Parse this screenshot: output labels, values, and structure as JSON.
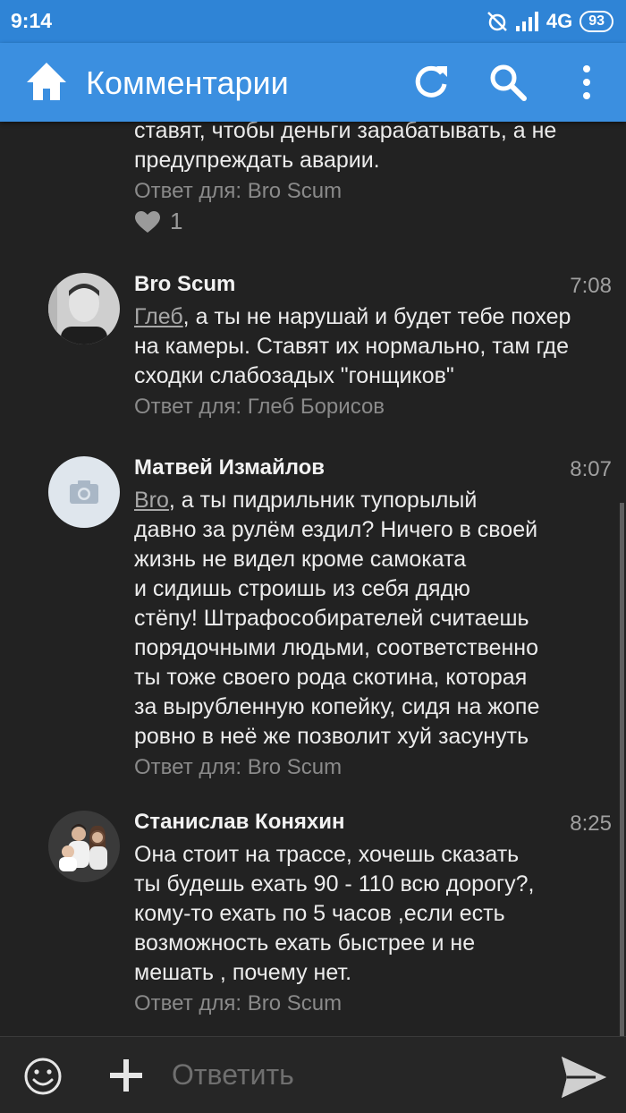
{
  "status_bar": {
    "time": "9:14",
    "network": "4G",
    "battery": "93"
  },
  "header": {
    "title": "Комментарии"
  },
  "comments": [
    {
      "partial_lines": [
        "ставят, чтобы деньги зарабатывать, а не",
        "предупреждать аварии."
      ],
      "reply_to": "Ответ для: Bro Scum",
      "likes": "1"
    },
    {
      "author": "Bro Scum",
      "time": "7:08",
      "mention": "Глеб",
      "lines": [
        ", а ты не нарушай и будет тебе похер",
        "на камеры. Ставят их нормально, там где",
        "сходки слабозадых \"гонщиков\""
      ],
      "reply_to": "Ответ для: Глеб Борисов"
    },
    {
      "author": "Матвей Измайлов",
      "time": "8:07",
      "mention": "Bro",
      "lines": [
        ", а ты пидрильник тупорылый",
        "давно за рулём ездил? Ничего в своей",
        "жизнь не видел кроме самоката",
        "и сидишь строишь из себя дядю",
        "стёпу! Штрафособирателей считаешь",
        "порядочными людьми, соответственно",
        "ты тоже своего рода скотина, которая",
        "за вырубленную копейку, сидя на жопе",
        "ровно в неё же позволит хуй засунуть"
      ],
      "reply_to": "Ответ для: Bro Scum"
    },
    {
      "author": "Станислав Коняхин",
      "time": "8:25",
      "lines": [
        "Она стоит на трассе, хочешь сказать",
        "ты будешь ехать 90 - 110 всю дорогу?,",
        "кому-то ехать по 5 часов ,если есть",
        "возможность ехать быстрее и не",
        "мешать , почему нет."
      ],
      "reply_to": "Ответ для: Bro Scum"
    }
  ],
  "composer": {
    "placeholder": "Ответить"
  },
  "colors": {
    "status_bar": "#2f84d6",
    "app_bar": "#3b8fe0",
    "background": "#222222"
  }
}
